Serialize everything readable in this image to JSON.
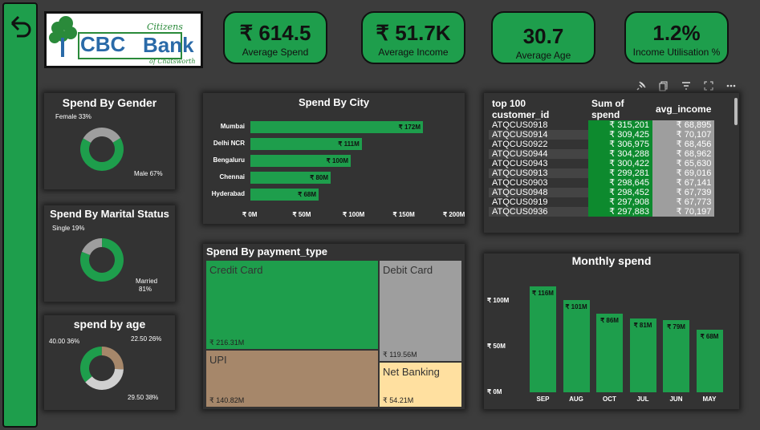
{
  "kpis": [
    {
      "value": "₹ 614.5",
      "label": "Average Spend"
    },
    {
      "value": "₹ 51.7K",
      "label": "Average Income"
    },
    {
      "value": "30.7",
      "label": "Average Age"
    },
    {
      "value": "1.2%",
      "label": "Income Utilisation %"
    }
  ],
  "logo": {
    "citizens": "Citizens",
    "cbc": "CBC",
    "bank": "Bank",
    "sub": "of Chatsworth"
  },
  "gender": {
    "title": "Spend By Gender",
    "labels": [
      "Female 33%",
      "Male 67%"
    ],
    "chart_data": {
      "type": "pie",
      "categories": [
        "Female",
        "Male"
      ],
      "values": [
        33,
        67
      ]
    }
  },
  "marital": {
    "title": "Spend By Marital Status",
    "labels": [
      "Single 19%",
      "Married",
      "81%"
    ],
    "chart_data": {
      "type": "pie",
      "categories": [
        "Single",
        "Married"
      ],
      "values": [
        19,
        81
      ]
    }
  },
  "age": {
    "title": "spend by age",
    "labels": [
      "40.00 36%",
      "22.50 26%",
      "29.50 38%"
    ],
    "chart_data": {
      "type": "pie",
      "categories": [
        "40.00",
        "22.50",
        "29.50"
      ],
      "values": [
        36,
        26,
        38
      ]
    }
  },
  "city": {
    "title": "Spend By City",
    "x_ticks": [
      "₹ 0M",
      "₹ 50M",
      "₹ 100M",
      "₹ 150M",
      "₹ 200M"
    ],
    "bar_labels": [
      "₹ 172M",
      "₹ 111M",
      "₹ 100M",
      "₹ 80M",
      "₹ 68M"
    ],
    "chart_data": {
      "type": "bar",
      "categories": [
        "Mumbai",
        "Delhi NCR",
        "Bengaluru",
        "Chennai",
        "Hyderabad"
      ],
      "values": [
        172,
        111,
        100,
        80,
        68
      ],
      "xlim": [
        0,
        200
      ]
    }
  },
  "payment": {
    "title": "Spend By payment_type",
    "labels": [
      "₹ 216.31M",
      "₹ 119.56M",
      "₹ 140.82M",
      "₹ 54.21M"
    ],
    "chart_data": {
      "type": "table",
      "categories": [
        "Credit Card",
        "Debit Card",
        "UPI",
        "Net Banking"
      ],
      "values": [
        216.31,
        119.56,
        140.82,
        54.21
      ]
    }
  },
  "table": {
    "headers": [
      "top 100 customer_id",
      "Sum of spend",
      "avg_income"
    ],
    "rows": [
      [
        "ATQCUS0918",
        "₹ 315,201",
        "₹ 68,895"
      ],
      [
        "ATQCUS0914",
        "₹ 309,425",
        "₹ 70,107"
      ],
      [
        "ATQCUS0922",
        "₹ 306,975",
        "₹ 68,456"
      ],
      [
        "ATQCUS0944",
        "₹ 304,288",
        "₹ 68,962"
      ],
      [
        "ATQCUS0943",
        "₹ 300,422",
        "₹ 65,630"
      ],
      [
        "ATQCUS0913",
        "₹ 299,281",
        "₹ 69,016"
      ],
      [
        "ATQCUS0903",
        "₹ 298,645",
        "₹ 67,141"
      ],
      [
        "ATQCUS0948",
        "₹ 298,452",
        "₹ 67,739"
      ],
      [
        "ATQCUS0919",
        "₹ 297,908",
        "₹ 67,773"
      ],
      [
        "ATQCUS0936",
        "₹ 297,883",
        "₹ 70,197"
      ]
    ]
  },
  "monthly": {
    "title": "Monthly spend",
    "y_ticks": [
      "₹ 100M",
      "₹ 50M",
      "₹ 0M"
    ],
    "bar_labels": [
      "₹ 116M",
      "₹ 101M",
      "₹ 86M",
      "₹ 81M",
      "₹ 79M",
      "₹ 68M"
    ],
    "chart_data": {
      "type": "bar",
      "categories": [
        "SEP",
        "AUG",
        "OCT",
        "JUL",
        "JUN",
        "MAY"
      ],
      "values": [
        116,
        101,
        86,
        81,
        79,
        68
      ],
      "ylim": [
        0,
        120
      ]
    }
  },
  "icons": [
    "pin-icon",
    "copy-icon",
    "filter-icon",
    "expand-icon",
    "more-icon",
    "back-arrow-icon"
  ]
}
